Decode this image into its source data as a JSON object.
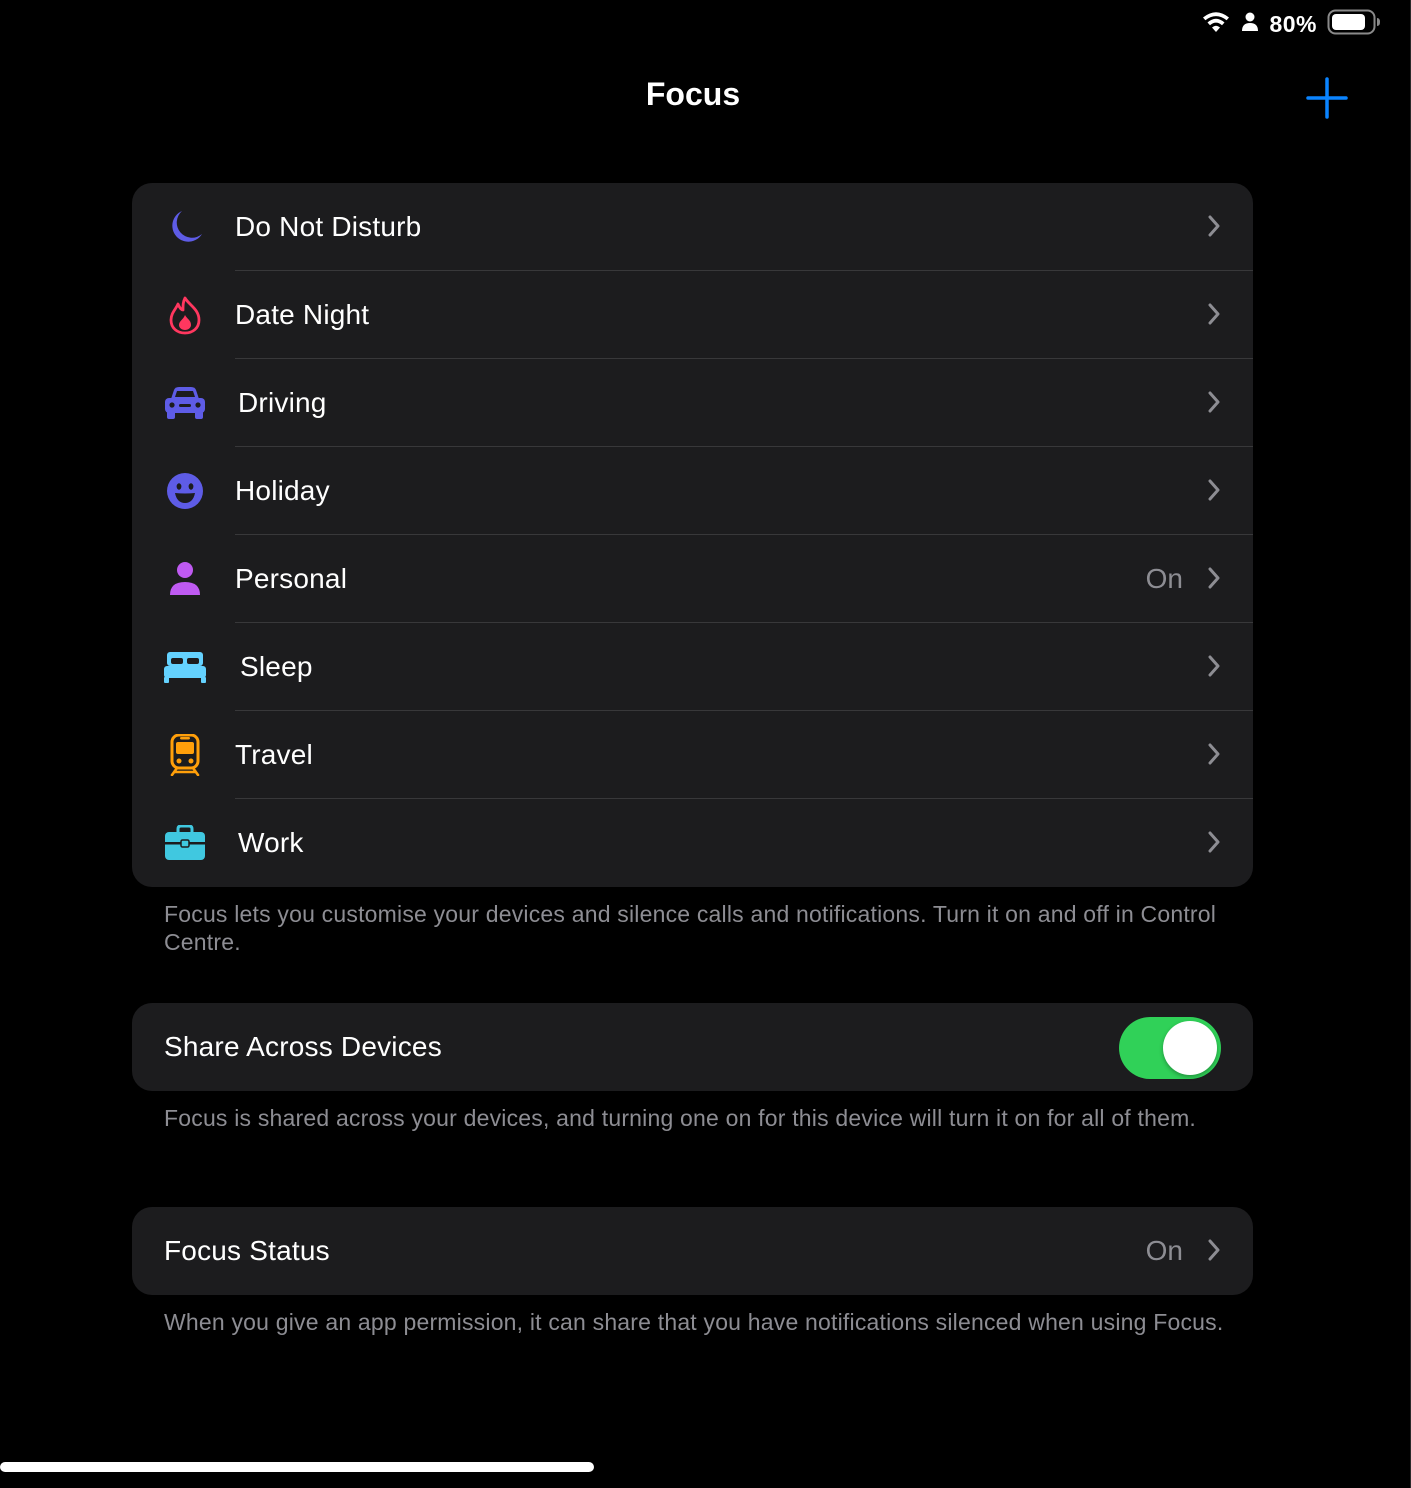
{
  "status_bar": {
    "battery_percent": "80%",
    "icons": [
      "wifi-icon",
      "person-icon",
      "battery-icon"
    ]
  },
  "nav": {
    "title": "Focus",
    "add_icon": "plus-icon"
  },
  "focus_modes": [
    {
      "label": "Do Not Disturb",
      "icon": "moon-icon",
      "icon_color": "#5e5ce6",
      "value": ""
    },
    {
      "label": "Date Night",
      "icon": "flame-icon",
      "icon_color": "#ff375f",
      "value": ""
    },
    {
      "label": "Driving",
      "icon": "car-icon",
      "icon_color": "#5e5ce6",
      "value": ""
    },
    {
      "label": "Holiday",
      "icon": "smiley-icon",
      "icon_color": "#5e5ce6",
      "value": ""
    },
    {
      "label": "Personal",
      "icon": "person-icon",
      "icon_color": "#bf5af2",
      "value": "On"
    },
    {
      "label": "Sleep",
      "icon": "bed-icon",
      "icon_color": "#64d2ff",
      "value": ""
    },
    {
      "label": "Travel",
      "icon": "tram-icon",
      "icon_color": "#ff9f0a",
      "value": ""
    },
    {
      "label": "Work",
      "icon": "briefcase-icon",
      "icon_color": "#40c8e0",
      "value": ""
    }
  ],
  "focus_modes_footer": "Focus lets you customise your devices and silence calls and notifications. Turn it on and off in Control Centre.",
  "share_across_devices": {
    "label": "Share Across Devices",
    "enabled": true,
    "toggle_color": "#30d158",
    "footer": "Focus is shared across your devices, and turning one on for this device will turn it on for all of them."
  },
  "focus_status": {
    "label": "Focus Status",
    "value": "On",
    "footer": "When you give an app permission, it can share that you have notifications silenced when using Focus."
  },
  "colors": {
    "background": "#000000",
    "group_background": "#1c1c1e",
    "accent": "#0a84ff",
    "secondary_text": "#8d8d93"
  }
}
